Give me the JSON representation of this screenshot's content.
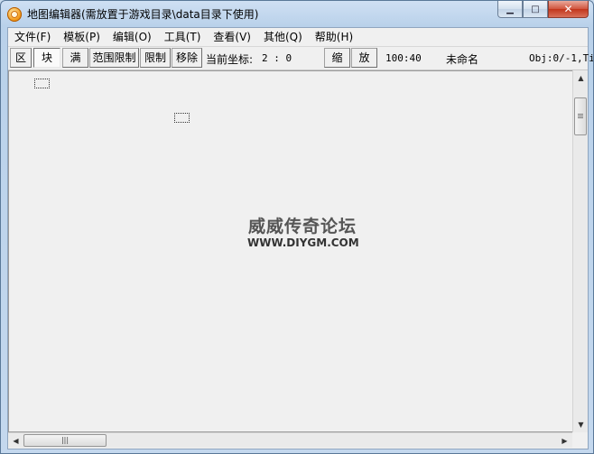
{
  "window": {
    "title": "地图编辑器(需放置于游戏目录\\data目录下使用)",
    "controls": {
      "minimize": "▁",
      "maximize": "□",
      "close": "✕"
    }
  },
  "menu": [
    "文件(F)",
    "模板(P)",
    "编辑(O)",
    "工具(T)",
    "查看(V)",
    "其他(Q)",
    "帮助(H)"
  ],
  "toolbar": {
    "btn_area": "区",
    "btn_block": "块",
    "btn_full": "满",
    "btn_range_limit": "范围限制",
    "btn_limit": "限制",
    "btn_remove": "移除",
    "coord_label": "当前坐标:",
    "coord_value": "2 : 0",
    "btn_zoom_out": "缩",
    "btn_zoom_in": "放",
    "zoom_value": "100:40",
    "file_name": "未命名",
    "obj_info": "Obj:0/-1,Ti"
  },
  "watermark": {
    "cn": "威威传奇论坛",
    "en": "WWW.DIYGM.COM"
  },
  "scrollbar": {
    "h_grip": "|||"
  }
}
